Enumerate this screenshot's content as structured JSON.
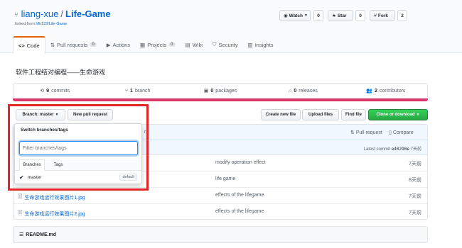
{
  "repo": {
    "owner": "liang-xue",
    "separator": "/",
    "name": "Life-Game",
    "forked_prefix": "forked from",
    "forked_from": "hfh123/Life-Game"
  },
  "actions": {
    "watch_label": "Watch",
    "watch_count": "0",
    "star_label": "Star",
    "star_count": "0",
    "fork_label": "Fork",
    "fork_count": "2"
  },
  "tabs": [
    {
      "label": "Code",
      "icon": "code-icon",
      "count": ""
    },
    {
      "label": "Pull requests",
      "icon": "pull-request-icon",
      "count": "0"
    },
    {
      "label": "Actions",
      "icon": "play-icon",
      "count": ""
    },
    {
      "label": "Projects",
      "icon": "project-icon",
      "count": "0"
    },
    {
      "label": "Wiki",
      "icon": "book-icon",
      "count": ""
    },
    {
      "label": "Security",
      "icon": "shield-icon",
      "count": ""
    },
    {
      "label": "Insights",
      "icon": "graph-icon",
      "count": ""
    }
  ],
  "description": "软件工程结对编程——生命游戏",
  "stats": {
    "commits_num": "9",
    "commits_label": "commits",
    "branch_num": "1",
    "branch_label": "branch",
    "packages_num": "0",
    "packages_label": "packages",
    "releases_num": "0",
    "releases_label": "releases",
    "contributors_num": "2",
    "contributors_label": "contributors"
  },
  "toolbar": {
    "branch_label": "Branch: master",
    "new_pr_label": "New pull request",
    "create_file_label": "Create new file",
    "upload_files_label": "Upload files",
    "find_file_label": "Find file",
    "clone_label": "Clone or download"
  },
  "commit_bar": {
    "truncated_text": "r.",
    "pull_request_label": "Pull request",
    "compare_label": "Compare",
    "latest_prefix": "Latest commit",
    "latest_hash": "e40290e",
    "latest_age": "7天前"
  },
  "dropdown": {
    "title": "Switch branches/tags",
    "filter_placeholder": "Filter branches/tags",
    "tab_branches": "Branches",
    "tab_tags": "Tags",
    "branch_name": "master",
    "branch_badge": "default"
  },
  "files": [
    {
      "name": "",
      "message": "modify operation effect",
      "age": "7天前"
    },
    {
      "name": "",
      "message": "life game",
      "age": "8天前"
    },
    {
      "name": "生命游戏运行效果图片1.jpg",
      "message": "effects of the lifegame",
      "age": "7天前"
    },
    {
      "name": "生命游戏运行效果图片2.jpg",
      "message": "effects of the lifegame",
      "age": "7天前"
    }
  ],
  "readme": {
    "label": "README.md"
  },
  "colors": {
    "link": "#0366d6",
    "language_bar": "#e0356a",
    "clone_button": "#28a745",
    "highlight_box": "#e4262b",
    "active_tab_border": "#e36209"
  }
}
